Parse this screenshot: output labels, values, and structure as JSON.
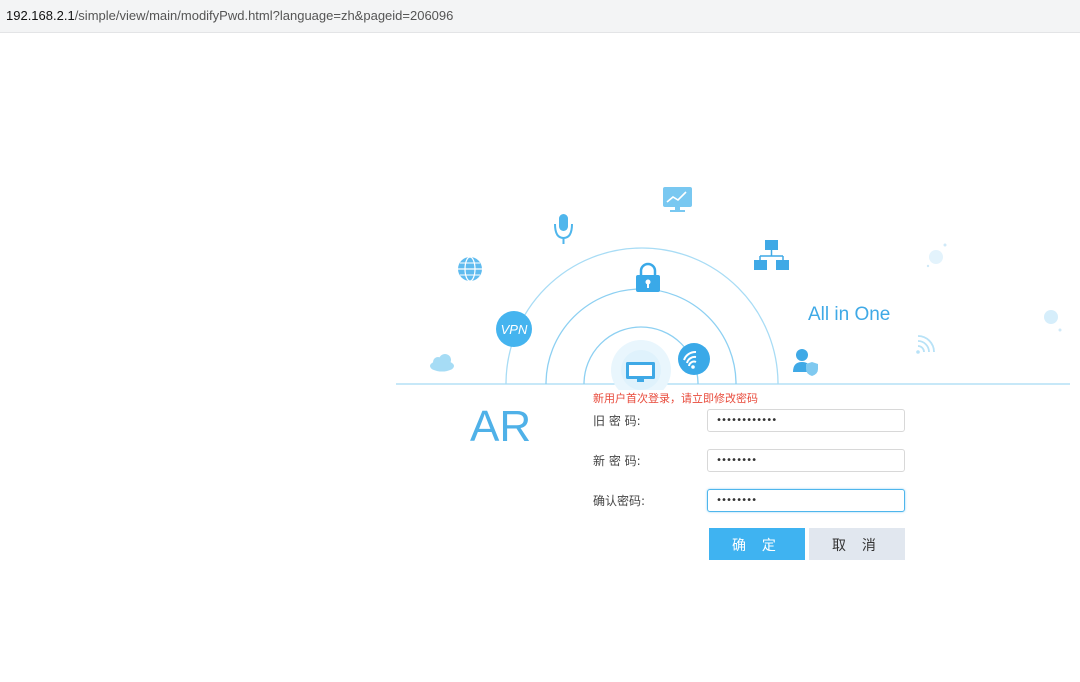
{
  "browser": {
    "url_host": "192.168.2.1",
    "url_path": "/simple/view/main/modifyPwd.html?language=zh&pageid=206096"
  },
  "brand": {
    "product": "AR",
    "slogan": "All in One",
    "accent_color": "#3fb3f1"
  },
  "hero_icons": [
    "cloud-icon",
    "globe-icon",
    "vpn-icon",
    "microphone-icon",
    "lock-icon",
    "monitor-chart-icon",
    "network-topology-icon",
    "desktop-icon",
    "wifi-icon",
    "user-shield-icon",
    "signal-icon"
  ],
  "hero_text": {
    "vpn": "VPN"
  },
  "form": {
    "notice": "新用户首次登录，请立即修改密码",
    "old_password_label": "旧 密 码:",
    "new_password_label": "新 密 码:",
    "confirm_password_label": "确认密码:",
    "old_password_value": "••••••••••••",
    "new_password_value": "••••••••",
    "confirm_password_value": "••••••••",
    "confirm_button": "确 定",
    "cancel_button": "取 消"
  }
}
